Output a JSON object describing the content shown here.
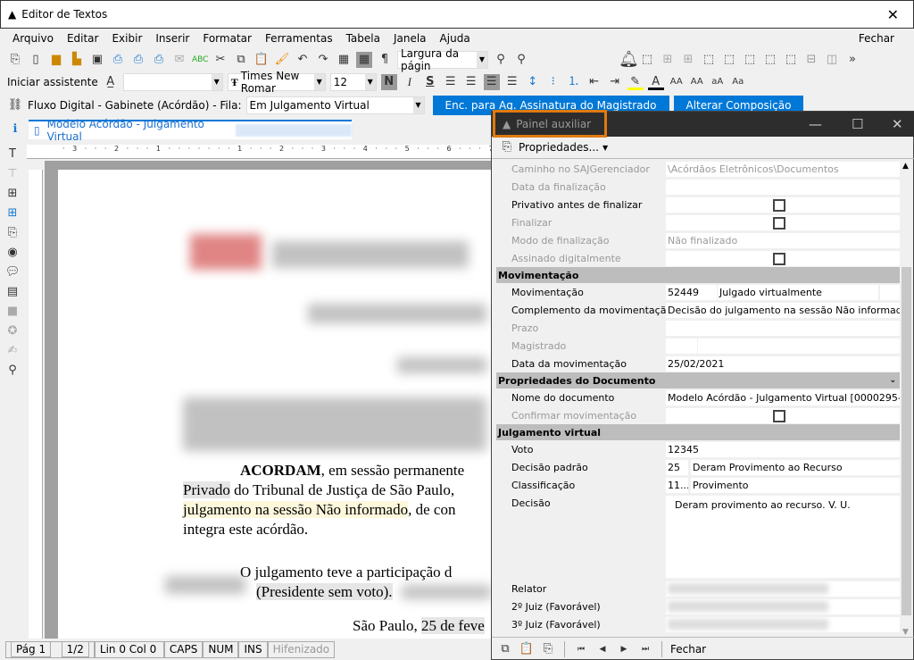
{
  "window": {
    "title": "Editor de Textos",
    "close_icon": "close-icon"
  },
  "menu": {
    "items": [
      "Arquivo",
      "Editar",
      "Exibir",
      "Inserir",
      "Formatar",
      "Ferramentas",
      "Tabela",
      "Janela",
      "Ajuda"
    ],
    "close": "Fechar"
  },
  "toolbar": {
    "zoom_value": "Largura da págin",
    "assistant": "Iniciar assistente",
    "style_value": "",
    "font_value": "Times New Romar",
    "size_value": "12",
    "bold": "N",
    "italic": "I",
    "underline": "S"
  },
  "flow": {
    "label": "Fluxo Digital - Gabinete (Acórdão) - Fila:",
    "queue_value": "Em Julgamento Virtual",
    "btn_forward": "Enc. para Ag. Assinatura do Magistrado",
    "btn_alter": "Alterar Composição"
  },
  "doc_tab": {
    "label": "Modelo Acórdão - Julgamento Virtual"
  },
  "ruler": {
    "h": "· 3 · · · 2 · · · 1 · · · · · · · 1 · · · 2 · · · 3 · · · 4 · · · 5 · · · 6 · · · 7 · · · 8 · · · 9 · · · 10 ·"
  },
  "document": {
    "p1_line1_bold": "ACORDAM",
    "p1_line1_rest": ", em sessão permanente",
    "p1_line2_hl": "Privado",
    "p1_line2_rest": " do Tribunal de Justiça de São Paulo,",
    "p1_line3_hl": "julgamento na sessão Não informado",
    "p1_line3_rest": ", de con",
    "p1_line4": "integra este acórdão.",
    "p2_line1": "O julgamento teve a participação d",
    "p2_line2": "(Presidente sem voto).",
    "p3_prefix": "São Paulo, ",
    "p3_date": "25 de feve"
  },
  "status": {
    "page": "Pág 1",
    "pages": "1/2",
    "linecol": "Lin 0  Col 0",
    "caps": "CAPS",
    "num": "NUM",
    "ins": "INS",
    "hyph": "Hifenizado"
  },
  "panel": {
    "title": "Painel auxiliar",
    "properties_btn": "Propriedades...",
    "rows_top": [
      {
        "label": "Caminho no SAJGerenciador",
        "value": "\\Acórdãos Eletrônicos\\Documentos",
        "disabled": true
      },
      {
        "label": "Data da finalização",
        "value": "",
        "disabled": true
      },
      {
        "label": "Privativo antes de finalizar",
        "checkbox": true,
        "checked": false,
        "disabled": false
      },
      {
        "label": "Finalizar",
        "checkbox": true,
        "checked": false,
        "disabled": true
      },
      {
        "label": "Modo de finalização",
        "value": "Não finalizado",
        "disabled": true
      },
      {
        "label": "Assinado digitalmente",
        "checkbox": true,
        "checked": false,
        "disabled": true
      }
    ],
    "sec_mov": "Movimentação",
    "mov": {
      "label": "Movimentação",
      "code": "52449",
      "desc": "Julgado virtualmente"
    },
    "compl": {
      "label": "Complemento da movimentação",
      "value": "Decisão do julgamento na sessão Não informado"
    },
    "prazo": {
      "label": "Prazo"
    },
    "magistrado": {
      "label": "Magistrado"
    },
    "data_mov": {
      "label": "Data da movimentação",
      "value": "25/02/2021"
    },
    "sec_doc": "Propriedades do Documento",
    "nome_doc": {
      "label": "Nome do documento",
      "value": "Modelo Acórdão - Julgamento Virtual [0000295-0..."
    },
    "confirmar": {
      "label": "Confirmar movimentação",
      "checked": false
    },
    "sec_jv": "Julgamento virtual",
    "voto": {
      "label": "Voto",
      "value": "12345"
    },
    "decisao_padrao": {
      "label": "Decisão padrão",
      "code": "25",
      "value": "Deram Provimento ao Recurso"
    },
    "classificacao": {
      "label": "Classificação",
      "code": "11...",
      "value": "Provimento"
    },
    "decisao": {
      "label": "Decisão",
      "value": "Deram provimento ao recurso. V. U."
    },
    "relator": {
      "label": "Relator"
    },
    "juiz2": {
      "label": "2º Juiz  (Favorável)"
    },
    "juiz3": {
      "label": "3º Juiz  (Favorável)"
    },
    "close": "Fechar"
  },
  "colors": {
    "accent": "#0078d7",
    "highlight_border": "#e07a10",
    "panel_title_bg": "#2d2d2d",
    "section_bg": "#bdbdbd"
  }
}
